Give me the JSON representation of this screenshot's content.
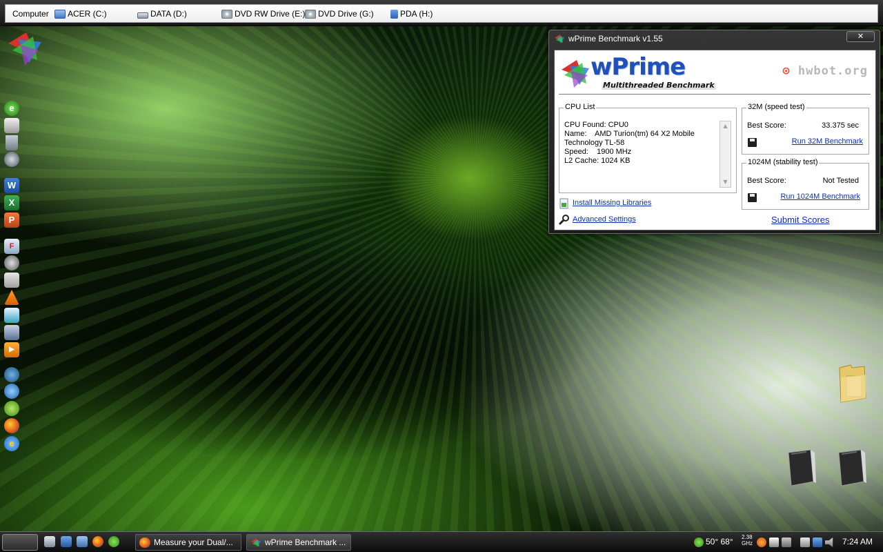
{
  "topbar": {
    "computer_label": "Computer",
    "drives": [
      {
        "label": "ACER (C:)",
        "icon": "hard-drive-c-icon"
      },
      {
        "label": "DATA (D:)",
        "icon": "hard-drive-icon"
      },
      {
        "label": "DVD RW Drive (E:)",
        "icon": "dvd-drive-icon"
      },
      {
        "label": "DVD Drive (G:)",
        "icon": "dvd-drive-icon"
      },
      {
        "label": "PDA (H:)",
        "icon": "pda-icon"
      }
    ]
  },
  "dock": {
    "icons": [
      "wprime-logo-icon",
      "messenger-icon",
      "finder-icon",
      "trash-icon",
      "network-icon",
      "word-icon",
      "excel-icon",
      "powerpoint-icon",
      "flash-icon",
      "media-icon",
      "document-icon",
      "vlc-icon",
      "publisher-icon",
      "tools-icon",
      "player-icon",
      "vista-icon",
      "google-earth-icon",
      "chip-icon",
      "firefox-icon",
      "internet-explorer-icon"
    ]
  },
  "window": {
    "title": "wPrime Benchmark v1.55",
    "close_label": "✕",
    "logo": {
      "name": "wPrime",
      "tagline": "Multithreaded Benchmark",
      "partner": "hwbot.org"
    },
    "cpu_list": {
      "legend": "CPU List",
      "text": "CPU Found: CPU0\nName:    AMD Turion(tm) 64 X2 Mobile\nTechnology TL-58\nSpeed:    1900 MHz\nL2 Cache: 1024 KB"
    },
    "test32": {
      "legend": "32M (speed test)",
      "score_label": "Best Score:",
      "score_value": "33.375 sec",
      "run_label": "Run 32M Benchmark"
    },
    "test1024": {
      "legend": "1024M (stability test)",
      "score_label": "Best Score:",
      "score_value": "Not Tested",
      "run_label": "Run 1024M Benchmark"
    },
    "install_label": "Install Missing Libraries",
    "advanced_label": "Advanced Settings",
    "submit_label": "Submit Scores"
  },
  "taskbar": {
    "tasks": [
      {
        "label": "Measure your Dual/...",
        "icon": "firefox-icon"
      },
      {
        "label": "wPrime Benchmark ...",
        "icon": "wprime-icon"
      }
    ],
    "tray": {
      "weather": "50° 68°",
      "cpu_speed": "2.38 GHz",
      "clock": "7:24 AM"
    }
  },
  "colors": {
    "link": "#0b2fb5",
    "wprime_blue": "#2050b8",
    "accent_green": "#5cc21e"
  }
}
